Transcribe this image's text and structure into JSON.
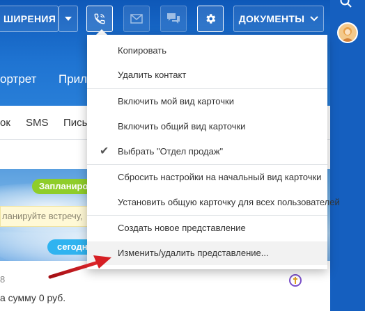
{
  "toolbar": {
    "extensions_label": "ШИРЕНИЯ",
    "documents_label": "ДОКУМЕНТЫ"
  },
  "nav": {
    "item1": "ортрет",
    "item2": "Прило"
  },
  "tabs": [
    "ок",
    "SMS",
    "Пись"
  ],
  "timeline": {
    "planned_badge": "Запланиро",
    "meeting_note": "ланируйте встречу,",
    "today_badge": "сегодн",
    "small_number": "8",
    "deal_text": "а сумму 0 руб."
  },
  "menu": {
    "items": [
      "Копировать",
      "Удалить контакт",
      "Включить мой вид карточки",
      "Включить общий вид карточки",
      "Выбрать \"Отдел продаж\"",
      "Сбросить настройки на начальный вид карточки",
      "Установить общую карточку для всех пользователей",
      "Создать новое представление",
      "Изменить/удалить представление..."
    ],
    "checked_index": 4,
    "hovered_index": 8
  },
  "colors": {
    "brand_blue": "#1e68c4",
    "planned_green": "#8fcd2a",
    "today_blue": "#2fb3f0",
    "annotation_red": "#c4161c"
  }
}
